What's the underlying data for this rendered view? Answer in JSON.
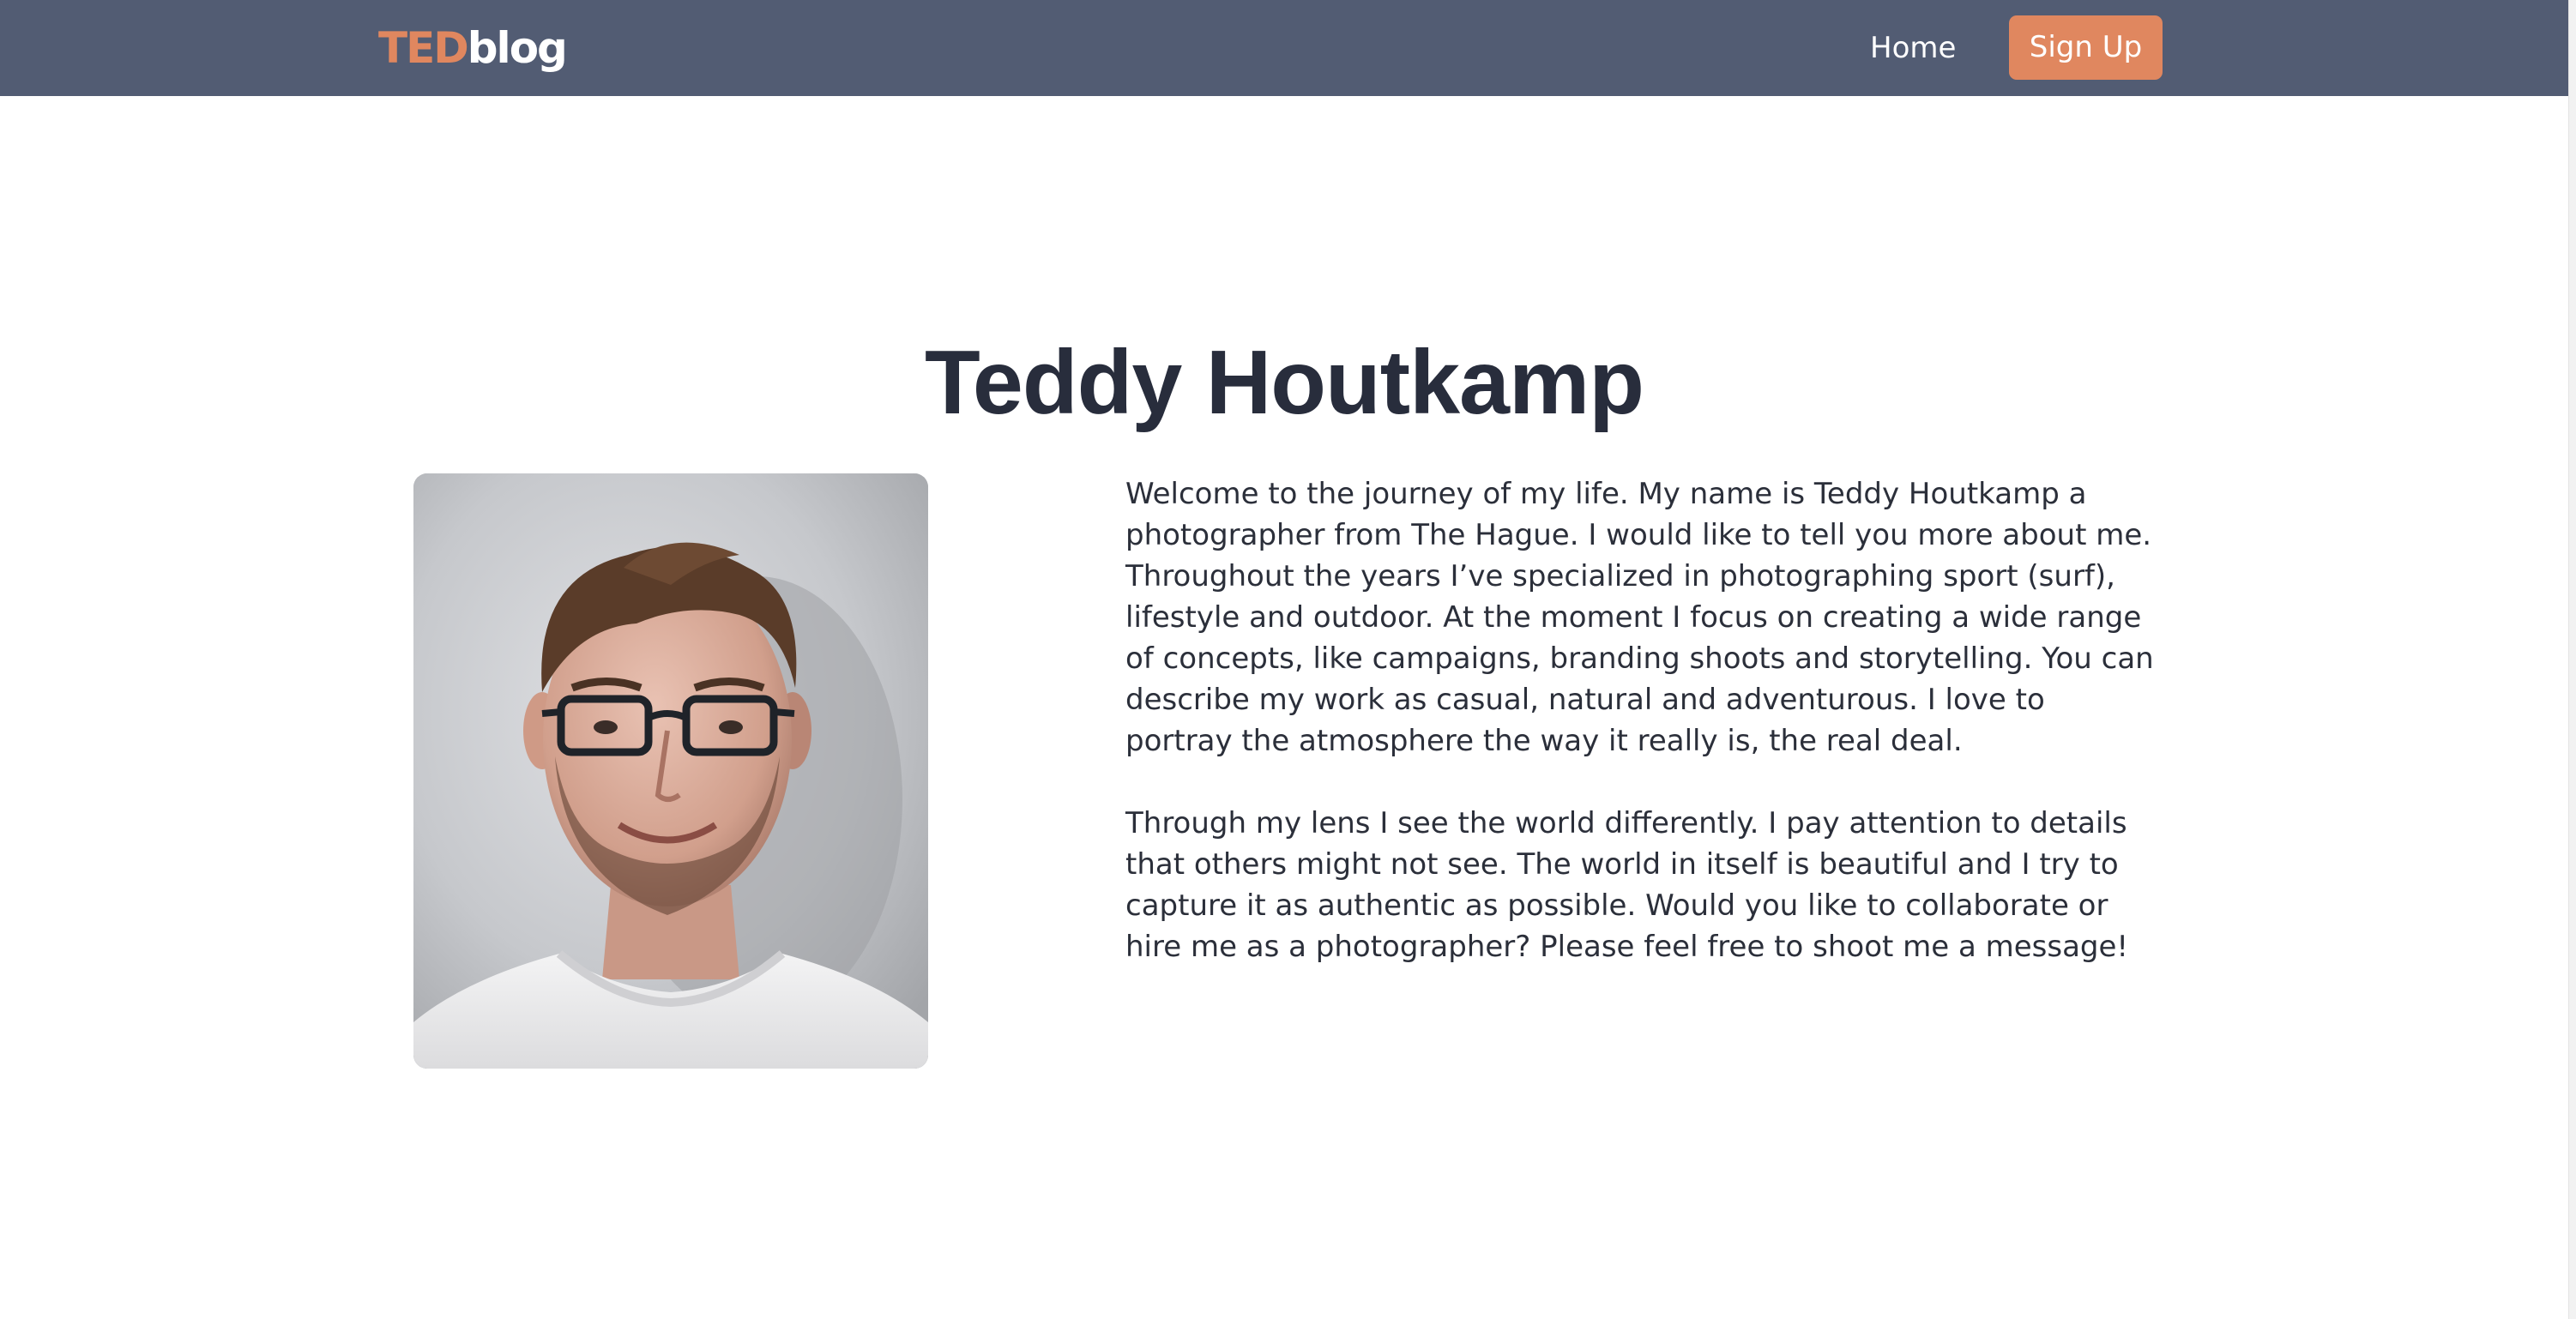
{
  "header": {
    "logo": {
      "part1": "TED",
      "part2": "blog"
    },
    "nav": {
      "home_label": "Home",
      "signup_label": "Sign Up"
    }
  },
  "main": {
    "title": "Teddy Houtkamp",
    "bio": [
      "Welcome to the journey of my life. My name is Teddy Houtkamp a photographer from The Hague. I would like to tell you more about me. Throughout the years I’ve specialized in photographing sport (surf), lifestyle and outdoor. At the moment I focus on creating a wide range of concepts, like campaigns, branding shoots and storytelling. You can describe my work as casual, natural and adventurous. I love to portray the atmosphere the way it really is, the real deal.",
      "Through my lens I see the world differently. I pay attention to details that others might not see. The world in itself is beautiful and I try to capture it as authentic as possible. Would you like to collaborate or hire me as a photographer? Please feel free to shoot me a message!"
    ]
  },
  "colors": {
    "navbar": "#525c73",
    "accent": "#e0875f",
    "title": "#282d3c",
    "text": "#2b2f3a"
  }
}
